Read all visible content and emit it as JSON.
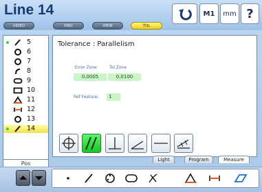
{
  "header": {
    "title": "Line 14",
    "mode_buttons": [
      {
        "label": "VIDEO",
        "active": false
      },
      {
        "label": "DRO",
        "active": false
      },
      {
        "label": "VIEW",
        "active": false
      },
      {
        "label": "TOL",
        "active": true
      }
    ],
    "top_buttons": {
      "undo_icon": "undo-arrow-icon",
      "m1": "M1",
      "units": "mm",
      "help": "?"
    }
  },
  "feature_list": {
    "items": [
      {
        "number": "5",
        "icon": "line-icon",
        "active_dot": true,
        "selected": false
      },
      {
        "number": "6",
        "icon": "circle-icon",
        "active_dot": false,
        "selected": false
      },
      {
        "number": "7",
        "icon": "circle-icon",
        "active_dot": false,
        "selected": false
      },
      {
        "number": "8",
        "icon": "arc-icon",
        "active_dot": false,
        "selected": false
      },
      {
        "number": "9",
        "icon": "slot-icon",
        "active_dot": false,
        "selected": false
      },
      {
        "number": "10",
        "icon": "rectangle-icon",
        "active_dot": false,
        "selected": false
      },
      {
        "number": "11",
        "icon": "angle-icon",
        "active_dot": false,
        "selected": false
      },
      {
        "number": "12",
        "icon": "distance-icon",
        "active_dot": false,
        "selected": false
      },
      {
        "number": "13",
        "icon": "circle-icon",
        "active_dot": false,
        "selected": false
      },
      {
        "number": "14",
        "icon": "line-icon",
        "active_dot": true,
        "selected": true
      }
    ],
    "footer_label": "Pos"
  },
  "tolerance": {
    "title": "Tolerance : Parallelism",
    "error_zone_label": "Error Zone",
    "error_zone_value": "0.0005",
    "tol_zone_label": "Tol Zone",
    "tol_zone_value": "0.0100",
    "ref_feature_label": "Ref Feature:",
    "ref_feature_value": "1",
    "tools": [
      {
        "icon": "position-icon",
        "active": false
      },
      {
        "icon": "parallelism-icon",
        "active": true
      },
      {
        "icon": "perpendicularity-icon",
        "active": false
      },
      {
        "icon": "angularity-icon",
        "active": false
      },
      {
        "icon": "straightness-icon",
        "active": false
      },
      {
        "icon": "runout-icon",
        "active": false
      }
    ]
  },
  "tabs": [
    {
      "label": "Light",
      "active": false
    },
    {
      "label": "Program",
      "active": false
    },
    {
      "label": "Measure",
      "active": true
    }
  ],
  "measure_bar": {
    "tools": [
      "point-icon",
      "line-icon",
      "circle-icon",
      "slot-icon",
      "blob-icon",
      "angle-icon",
      "distance-icon",
      "skew-icon"
    ]
  },
  "colors": {
    "header_bg": "#b8d4f0",
    "tol_active": "#f4d21e",
    "selected_row": "#f8ec6c",
    "active_tool": "#29d23a",
    "field_green": "#c9f5c9"
  }
}
